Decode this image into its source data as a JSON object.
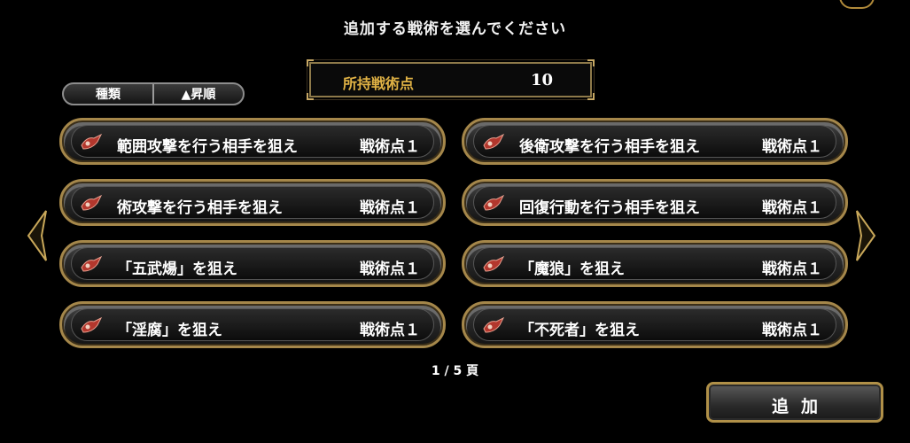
{
  "header": {
    "title": "追加する戦術を選んでください"
  },
  "points": {
    "label": "所持戦術点",
    "value": "10"
  },
  "sort": {
    "type_label": "種類",
    "order_label": "▲昇順"
  },
  "tactics": [
    {
      "name": "範囲攻撃を行う相手を狙え",
      "cost": "戦術点１"
    },
    {
      "name": "後衛攻撃を行う相手を狙え",
      "cost": "戦術点１"
    },
    {
      "name": "術攻撃を行う相手を狙え",
      "cost": "戦術点１"
    },
    {
      "name": "回復行動を行う相手を狙え",
      "cost": "戦術点１"
    },
    {
      "name": "「五武煬」を狙え",
      "cost": "戦術点１"
    },
    {
      "name": "「魔狼」を狙え",
      "cost": "戦術点１"
    },
    {
      "name": "「淫腐」を狙え",
      "cost": "戦術点１"
    },
    {
      "name": "「不死者」を狙え",
      "cost": "戦術点１"
    }
  ],
  "pager": {
    "text": "1 / 5 頁"
  },
  "actions": {
    "add_label": "追加"
  },
  "icons": {
    "tactic": "tactic-scroll-icon",
    "prev": "chevron-left-icon",
    "next": "chevron-right-icon"
  },
  "colors": {
    "gold": "#e0b245",
    "frame": "#a5874a"
  }
}
